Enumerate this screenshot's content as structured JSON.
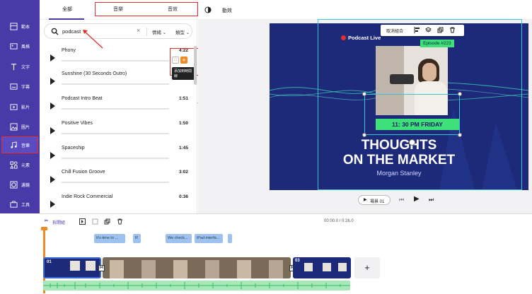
{
  "sidebar": {
    "items": [
      {
        "label": "範本",
        "icon": "template-icon"
      },
      {
        "label": "風格",
        "icon": "style-icon"
      },
      {
        "label": "文字",
        "icon": "text-icon"
      },
      {
        "label": "字幕",
        "icon": "subtitle-icon"
      },
      {
        "label": "影片",
        "icon": "video-icon"
      },
      {
        "label": "圖片",
        "icon": "image-icon"
      },
      {
        "label": "音樂",
        "icon": "music-icon",
        "active": true
      },
      {
        "label": "元素",
        "icon": "elements-icon"
      },
      {
        "label": "濾鏡",
        "icon": "filter-icon"
      },
      {
        "label": "工具",
        "icon": "tools-icon"
      }
    ]
  },
  "panel": {
    "tabs": [
      "全部",
      "音樂",
      "音效"
    ],
    "search_value": "podcast",
    "filter1": "情緒",
    "filter2": "類型",
    "tracks": [
      {
        "name": "Phony",
        "duration": "4:22"
      },
      {
        "name": "Sunshine (30 Seconds Outro)",
        "duration": ""
      },
      {
        "name": "Podcast Intro Beat",
        "duration": "1:51"
      },
      {
        "name": "Positive Vibes",
        "duration": "1:50"
      },
      {
        "name": "Spaceship",
        "duration": "1:45"
      },
      {
        "name": "Chill Fusion Groove",
        "duration": "3:02"
      },
      {
        "name": "Indie Rock Commercial",
        "duration": "0:36"
      }
    ],
    "add_tooltip": "添加到時間線"
  },
  "topbar": {
    "color_label": "",
    "animate_label": "動效"
  },
  "float_toolbar": {
    "ungroup_label": "取消組合"
  },
  "design": {
    "brand": "Podcast Live",
    "episode": "Episode #223",
    "time": "11: 30 PM FRIDAY",
    "title1": "THOUGHTS",
    "title2": "ON THE MARKET",
    "host": "Morgan Stanley"
  },
  "player": {
    "scene_label": "場景 01"
  },
  "timeline": {
    "split_label": "拆開組",
    "time_readout": "00:00.0 / 0:26.0",
    "captions": [
      "It's time to ...",
      "R",
      "We check...",
      "iPad interfa...",
      ""
    ],
    "clip_labels": [
      "01",
      "02",
      "03"
    ],
    "add_label": "+"
  },
  "colors": {
    "sidebar": "#4a3aa8",
    "highlight": "#e0312f",
    "design_bg": "#1d2a7a",
    "time_badge": "#3ee07a",
    "caption_chip": "#9ec1f0",
    "audio_track": "#a6e8b8"
  }
}
